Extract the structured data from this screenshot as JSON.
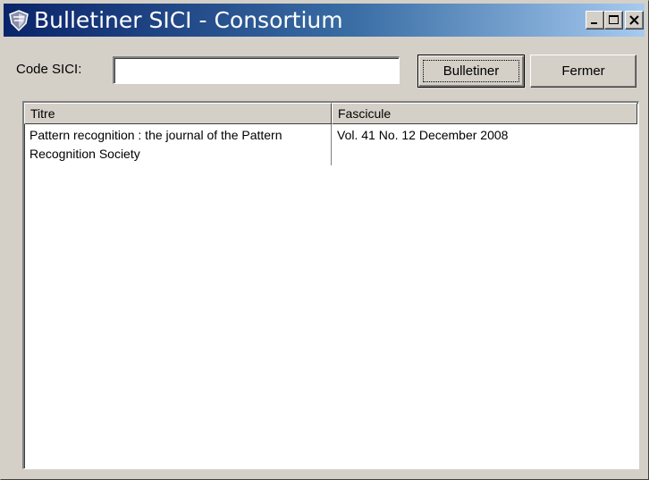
{
  "window": {
    "title": "Bulletiner SICI - Consortium",
    "icon": "app-shield-icon",
    "controls": [
      "minimize-icon",
      "maximize-icon",
      "close-icon"
    ]
  },
  "form": {
    "code_label": "Code SICI:",
    "code_value": "",
    "bulletiner_label": "Bulletiner",
    "fermer_label": "Fermer"
  },
  "table": {
    "columns": [
      "Titre",
      "Fascicule"
    ],
    "rows": [
      {
        "titre": "Pattern recognition : the journal of the Pattern Recognition Society",
        "fascicule": "Vol. 41 No. 12 December 2008"
      }
    ]
  },
  "colors": {
    "titlebar_start": "#0a246a",
    "titlebar_end": "#a6caf0",
    "face": "#d4d0c8"
  }
}
